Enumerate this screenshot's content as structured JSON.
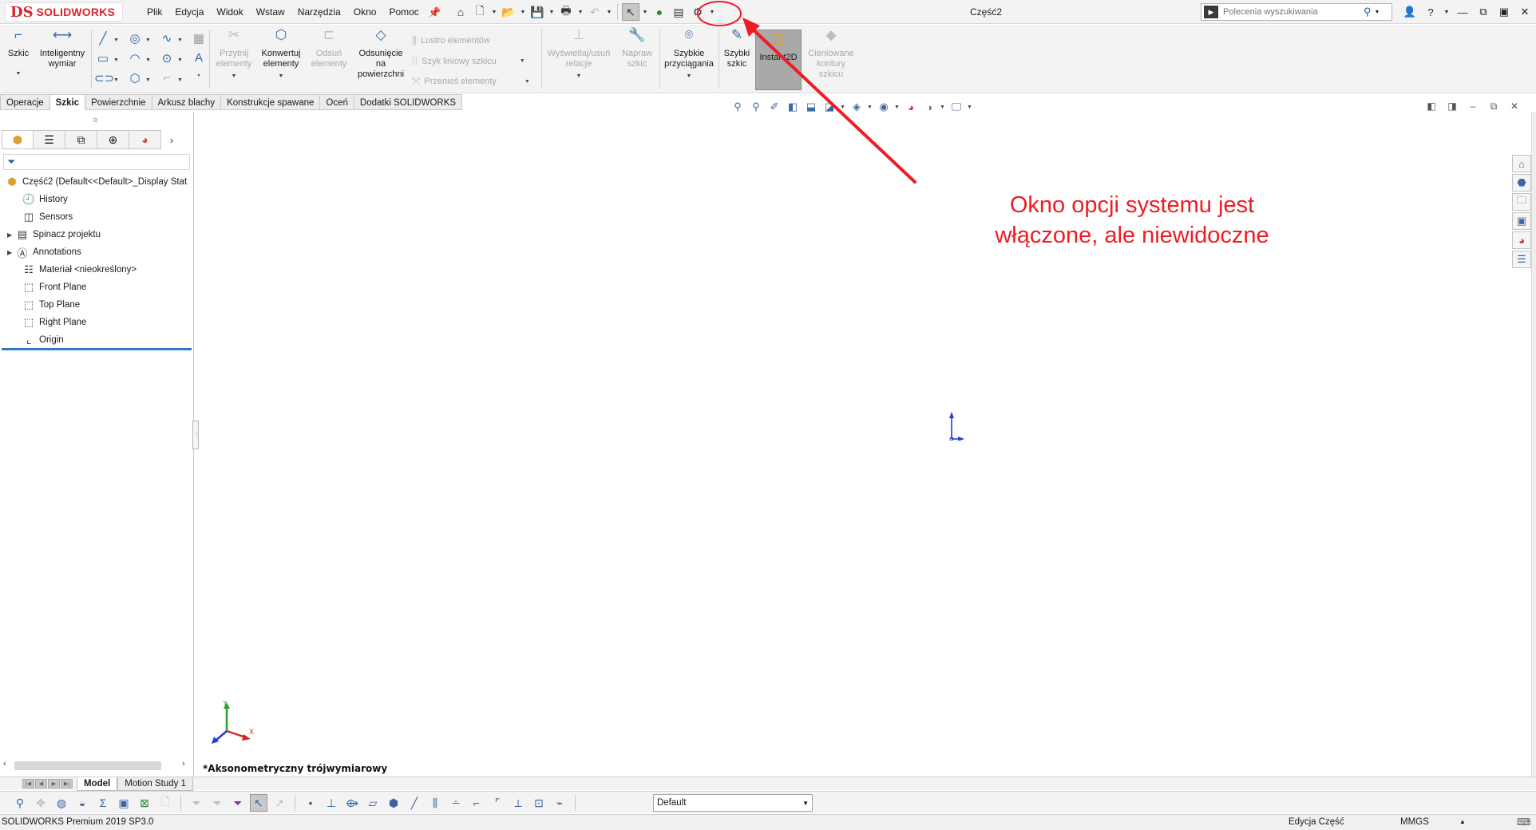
{
  "app": {
    "logo_text": "SOLIDWORKS",
    "logo_mark": "DS",
    "document_title": "Część2"
  },
  "menu": {
    "items": [
      "Plik",
      "Edycja",
      "Widok",
      "Wstaw",
      "Narzędzia",
      "Okno",
      "Pomoc"
    ]
  },
  "search": {
    "placeholder": "Polecenia wyszukiwania"
  },
  "ribbon": {
    "szkic": "Szkic",
    "inteligentny_wymiar_1": "Inteligentny",
    "inteligentny_wymiar_2": "wymiar",
    "przytnij_1": "Przytnij",
    "przytnij_2": "elementy",
    "konwertuj_1": "Konwertuj",
    "konwertuj_2": "elementy",
    "odsun_1": "Odsuń",
    "odsun_2": "elementy",
    "odsuniecie_1": "Odsunięcie",
    "odsuniecie_2": "na",
    "odsuniecie_3": "powierzchni",
    "lustro": "Lustro elementów",
    "szyk": "Szyk liniowy szkicu",
    "przenies": "Przenieś elementy",
    "wyswietlaj_1": "Wyświetlaj/usuń",
    "wyswietlaj_2": "relacje",
    "napraw_1": "Napraw",
    "napraw_2": "szkic",
    "szybkie_przyciagania_1": "Szybkie",
    "szybkie_przyciagania_2": "przyciągania",
    "szybki_szkic_1": "Szybki",
    "szybki_szkic_2": "szkic",
    "instant2d": "Instant2D",
    "cieniowane_1": "Cieniowane",
    "cieniowane_2": "kontury",
    "cieniowane_3": "szkicu"
  },
  "tabs": [
    "Operacje",
    "Szkic",
    "Powierzchnie",
    "Arkusz blachy",
    "Konstrukcje spawane",
    "Oceń",
    "Dodatki SOLIDWORKS"
  ],
  "active_tab": "Szkic",
  "feature_tree": {
    "root": "Część2  (Default<<Default>_Display Stat",
    "items": [
      {
        "label": "History",
        "icon": "history-icon"
      },
      {
        "label": "Sensors",
        "icon": "sensors-icon"
      },
      {
        "label": "Spinacz projektu",
        "icon": "design-binder-icon"
      },
      {
        "label": "Annotations",
        "icon": "annotations-icon"
      },
      {
        "label": "Materiał <nieokreślony>",
        "icon": "material-icon"
      },
      {
        "label": "Front Plane",
        "icon": "plane-icon"
      },
      {
        "label": "Top Plane",
        "icon": "plane-icon"
      },
      {
        "label": "Right Plane",
        "icon": "plane-icon"
      },
      {
        "label": "Origin",
        "icon": "origin-icon"
      }
    ]
  },
  "viewport": {
    "view_label": "*Aksonometryczny trójwymiarowy"
  },
  "annotation": {
    "line1": "Okno opcji systemu jest",
    "line2": "włączone, ale niewidoczne",
    "color": "#ee1c24"
  },
  "bottom_tabs": [
    "Model",
    "Motion Study 1"
  ],
  "configuration": {
    "selected": "Default"
  },
  "status": {
    "product": "SOLIDWORKS Premium 2019 SP3.0",
    "mode": "Edycja Część",
    "units": "MMGS"
  }
}
